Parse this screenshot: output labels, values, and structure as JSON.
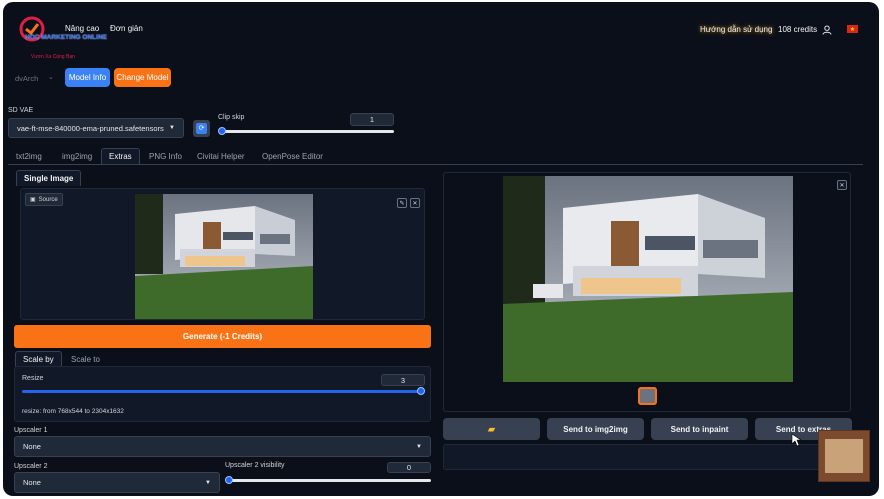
{
  "header": {
    "logo_text": "HOC MARKETING ONLINE",
    "logo_tagline": "Vươn Xa Cùng Bạn",
    "nav_item_1": "Nâng cao",
    "nav_item_2": "Đơn giản",
    "guide_link": "Hướng dẫn sử dụng",
    "credits": "108 credits"
  },
  "toolbar": {
    "model_select": "dvArch",
    "model_info_label": "Model Info",
    "change_model_label": "Change Model"
  },
  "settings": {
    "sd_vae_label": "SD VAE",
    "sd_vae_value": "vae-ft-mse-840000-ema-pruned.safetensors",
    "clip_skip_label": "Clip skip",
    "clip_skip_value": "1"
  },
  "tabs": [
    "txt2img",
    "img2img",
    "Extras",
    "PNG Info",
    "Civitai Helper",
    "OpenPose Editor"
  ],
  "extras": {
    "single_image_tab": "Single Image",
    "source_label": "Source",
    "generate_label": "Generate (-1 Credits)",
    "scale_by_tab": "Scale by",
    "scale_to_tab": "Scale to",
    "resize_label": "Resize",
    "resize_value": "3",
    "resize_fraction": 1.0,
    "resize_info": "resize: from 768x544 to 2304x1632",
    "upscaler1_label": "Upscaler 1",
    "upscaler1_value": "None",
    "upscaler2_label": "Upscaler 2",
    "upscaler2_value": "None",
    "upscaler2_visibility_label": "Upscaler 2 visibility",
    "upscaler2_visibility_value": "0"
  },
  "output": {
    "send_img2img": "Send to img2img",
    "send_inpaint": "Send to inpaint",
    "send_extras": "Send to extras"
  },
  "colors": {
    "accent_orange": "#f97316",
    "accent_blue": "#2563eb",
    "background": "#0b0f19",
    "panel": "#111827"
  }
}
